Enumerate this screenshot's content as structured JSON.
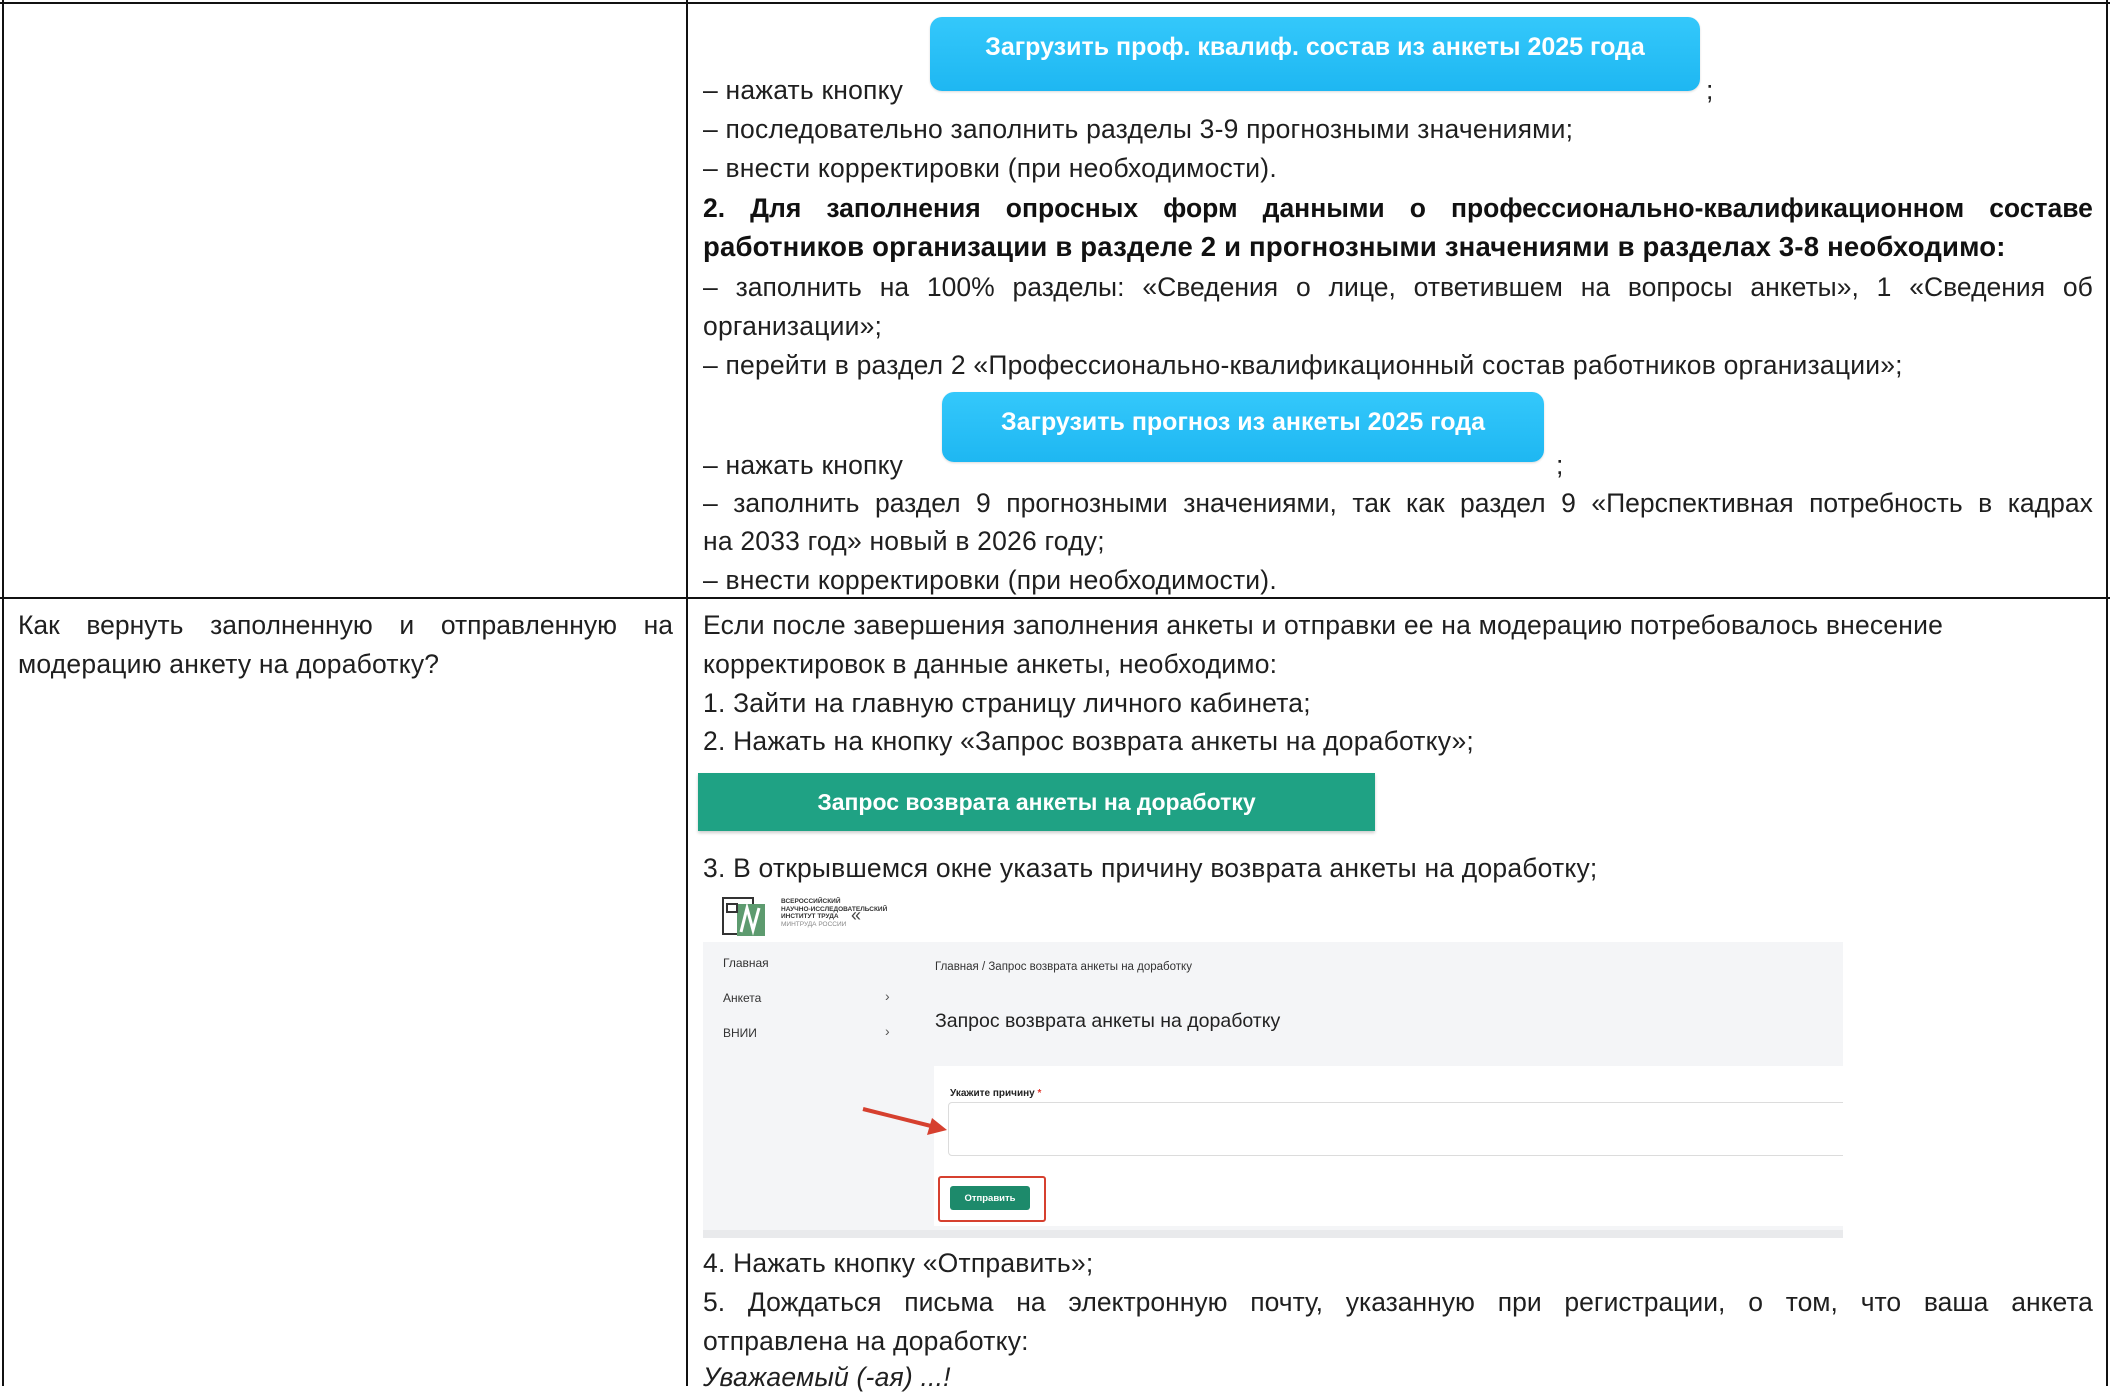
{
  "row1": {
    "upload_button_label": "Загрузить проф. квалиф. состав из анкеты 2025 года",
    "press_button": "– нажать кнопку",
    "semicolon": ";",
    "fill_sections": "– последовательно заполнить разделы 3-9 прогнозными значениями;",
    "make_corrections": "– внести корректировки (при необходимости).",
    "heading_line1_words": [
      "2.",
      "Для",
      "заполнения",
      "опросных",
      "форм",
      "данными",
      "о",
      "профессионально-квалификационном",
      "составе"
    ],
    "heading_line2": "работников организации в разделе 2 и прогнозными значениями в разделах 3-8 необходимо:",
    "fill_100_words": [
      "–",
      "заполнить",
      "на",
      "100%",
      "разделы:",
      "«Сведения",
      "о",
      "лице,",
      "ответившем",
      "на",
      "вопросы",
      "анкеты»,",
      "1",
      "«Сведения",
      "об"
    ],
    "fill_100_cont": "организации»;",
    "go_section2": "– перейти в раздел 2 «Профессионально-квалификационный состав работников организации»;",
    "forecast_button_label": "Загрузить прогноз из анкеты 2025 года",
    "press_button2": "– нажать кнопку",
    "semicolon2": ";",
    "fill_section9_words": [
      "–",
      "заполнить",
      "раздел",
      "9",
      "прогнозными",
      "значениями,",
      "так",
      "как",
      "раздел",
      "9",
      "«Перспективная",
      "потребность",
      "в",
      "кадрах"
    ],
    "fill_section9_cont": "на 2033 год» новый в 2026 году;",
    "make_corrections2": "– внести корректировки (при необходимости)."
  },
  "row2": {
    "question_words": [
      "Как",
      "вернуть",
      "заполненную",
      "и",
      "отправленную",
      "на"
    ],
    "question_cont": "модерацию анкету на доработку?",
    "intro_line1": "Если после завершения заполнения анкеты и отправки ее на модерацию потребовалось внесение",
    "intro_line2": "корректировок в данные анкеты, необходимо:",
    "step1": "1. Зайти на главную страницу личного кабинета;",
    "step2": "2. Нажать на кнопку «Запрос возврата анкеты на доработку»;",
    "return_button_label": "Запрос возврата анкеты на доработку",
    "step3": "3. В открывшемся окне указать причину возврата анкеты на доработку;",
    "step4": "4. Нажать кнопку «Отправить»;",
    "step5_words": [
      "5.",
      "Дождаться",
      "письма",
      "на",
      "электронную",
      "почту,",
      "указанную",
      "при",
      "регистрации,",
      "о",
      "том,",
      "что",
      "ваша",
      "анкета"
    ],
    "step5_cont": "отправлена на доработку:",
    "greeting": "Уважаемый (-ая) ...!"
  },
  "screenshot": {
    "org_line1": "ВСЕРОССИЙСКИЙ",
    "org_line2": "НАУЧНО-ИССЛЕДОВАТЕЛЬСКИЙ",
    "org_line3": "ИНСТИТУТ ТРУДА",
    "org_line4": "МИНТРУДА РОССИИ",
    "collapse": "«",
    "nav_home": "Главная",
    "nav_survey": "Анкета",
    "nav_vnii": "ВНИИ",
    "chevron": "›",
    "breadcrumb": "Главная / Запрос возврата анкеты на доработку",
    "title": "Запрос возврата анкеты на доработку",
    "reason_label": "Укажите причину",
    "required_mark": " *",
    "send_button": "Отправить"
  },
  "colors": {
    "blue_button": "#22bbf4",
    "green_button": "#1fa284",
    "send_button": "#1d8a6b",
    "highlight_red": "#d6402f"
  }
}
